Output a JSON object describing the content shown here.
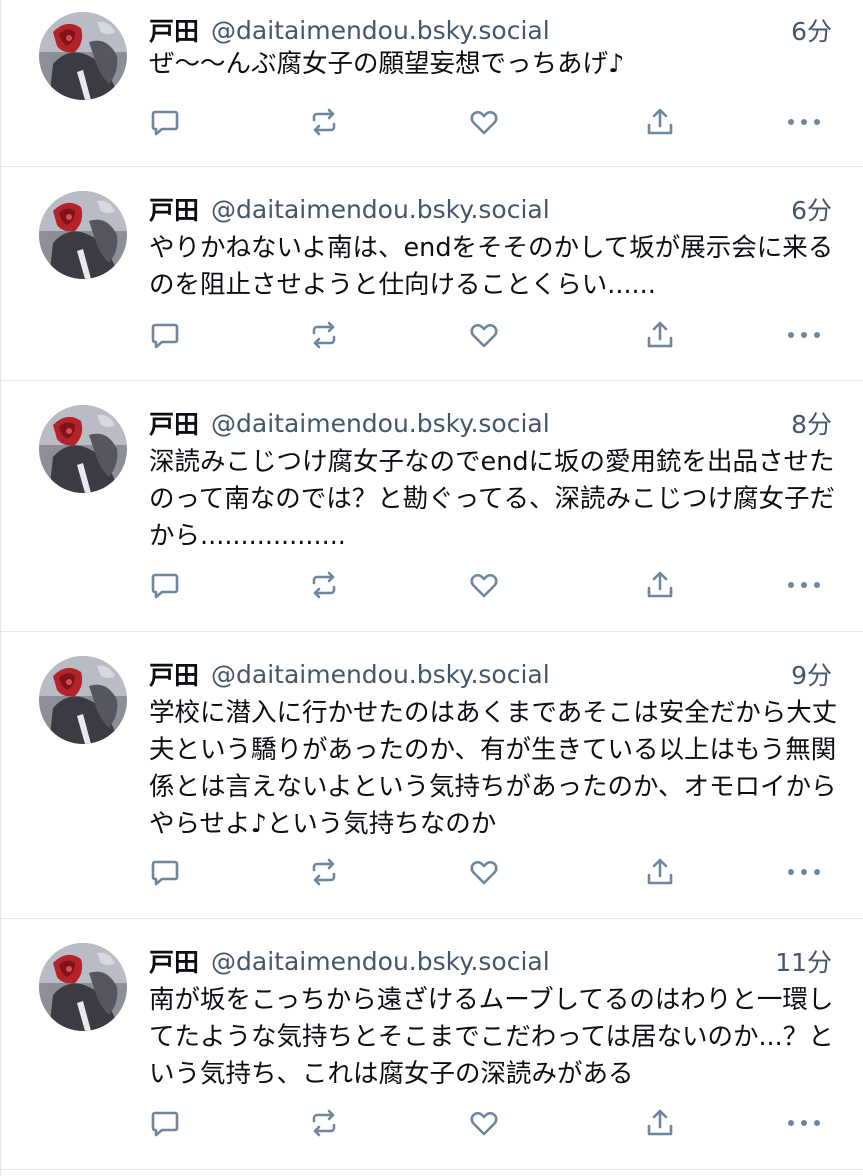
{
  "colors": {
    "text": "#0b0f14",
    "secondary": "#42576c",
    "icon": "#6f869f",
    "divider": "#e4e8ec"
  },
  "posts": [
    {
      "display_name": "戸田",
      "handle": "@daitaimendou.bsky.social",
      "time": "6分",
      "text": "ぜ〜〜んぶ腐女子の願望妄想でっちあげ♪"
    },
    {
      "display_name": "戸田",
      "handle": "@daitaimendou.bsky.social",
      "time": "6分",
      "text": "やりかねないよ南は、endをそそのかして坂が展示会に来るのを阻止させようと仕向けることくらい......"
    },
    {
      "display_name": "戸田",
      "handle": "@daitaimendou.bsky.social",
      "time": "8分",
      "text": "深読みこじつけ腐女子なのでendに坂の愛用銃を出品させたのって南なのでは？と勘ぐってる、深読みこじつけ腐女子だから.................."
    },
    {
      "display_name": "戸田",
      "handle": "@daitaimendou.bsky.social",
      "time": "9分",
      "text": "学校に潜入に行かせたのはあくまであそこは安全だから大丈夫という驕りがあったのか、有が生きている以上はもう無関係とは言えないよという気持ちがあったのか、オモロイからやらせよ♪という気持ちなのか"
    },
    {
      "display_name": "戸田",
      "handle": "@daitaimendou.bsky.social",
      "time": "11分",
      "text": "南が坂をこっちから遠ざけるムーブしてるのはわりと一環してたような気持ちとそこまでこだわっては居ないのか...？という気持ち、これは腐女子の深読みがある"
    }
  ],
  "action_icons": [
    "reply-icon",
    "repost-icon",
    "like-icon",
    "share-icon",
    "more-icon"
  ]
}
